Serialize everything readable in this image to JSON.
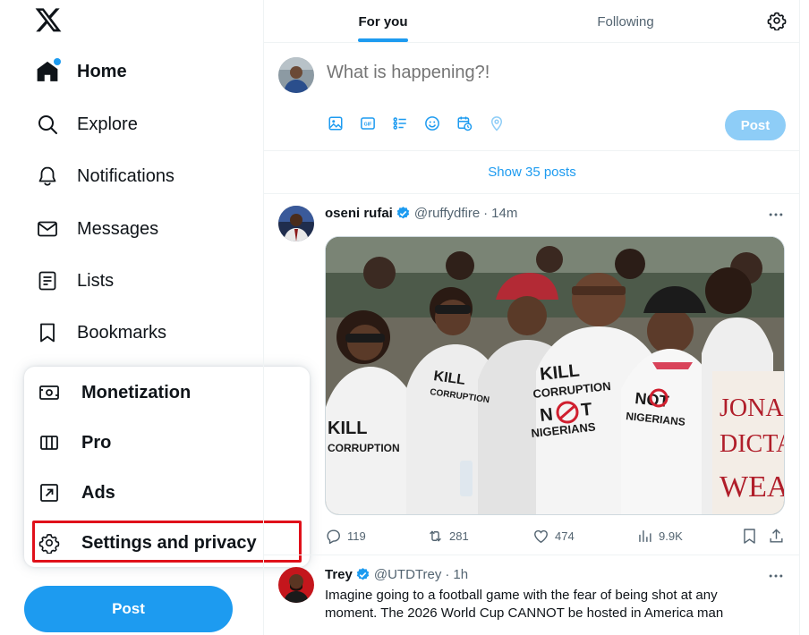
{
  "sidebar": {
    "logo": "x-logo",
    "items": [
      {
        "label": "Home",
        "icon": "home-icon"
      },
      {
        "label": "Explore",
        "icon": "search-icon"
      },
      {
        "label": "Notifications",
        "icon": "bell-icon"
      },
      {
        "label": "Messages",
        "icon": "envelope-icon"
      },
      {
        "label": "Lists",
        "icon": "list-icon"
      },
      {
        "label": "Bookmarks",
        "icon": "bookmark-icon"
      }
    ],
    "post_label": "Post"
  },
  "popup": {
    "items": [
      {
        "label": "Monetization",
        "icon": "money-icon"
      },
      {
        "label": "Pro",
        "icon": "columns-icon"
      },
      {
        "label": "Ads",
        "icon": "ads-arrow-icon"
      },
      {
        "label": "Settings and privacy",
        "icon": "gear-icon"
      }
    ],
    "highlight_color": "#e0101a"
  },
  "tabs": {
    "for_you": "For you",
    "following": "Following",
    "accent": "#1d9bf0"
  },
  "composer": {
    "placeholder": "What is happening?!",
    "post_label": "Post"
  },
  "feed": {
    "show_posts": "Show 35 posts",
    "tweets": [
      {
        "name": "oseni rufai",
        "handle": "@ruffydfire",
        "dot": "·",
        "time": "14m",
        "image_texts": {
          "shirt_a": "KILL CORRUPTION NOT NIGERIANS",
          "sign": "JONA DICTA WEA"
        },
        "replies": "119",
        "reposts": "281",
        "likes": "474",
        "views": "9.9K"
      },
      {
        "name": "Trey",
        "handle": "@UTDTrey",
        "dot": "·",
        "time": "1h",
        "text": "Imagine going to a football game with the fear of being shot at any moment. The 2026 World Cup CANNOT be hosted in America man"
      }
    ]
  }
}
